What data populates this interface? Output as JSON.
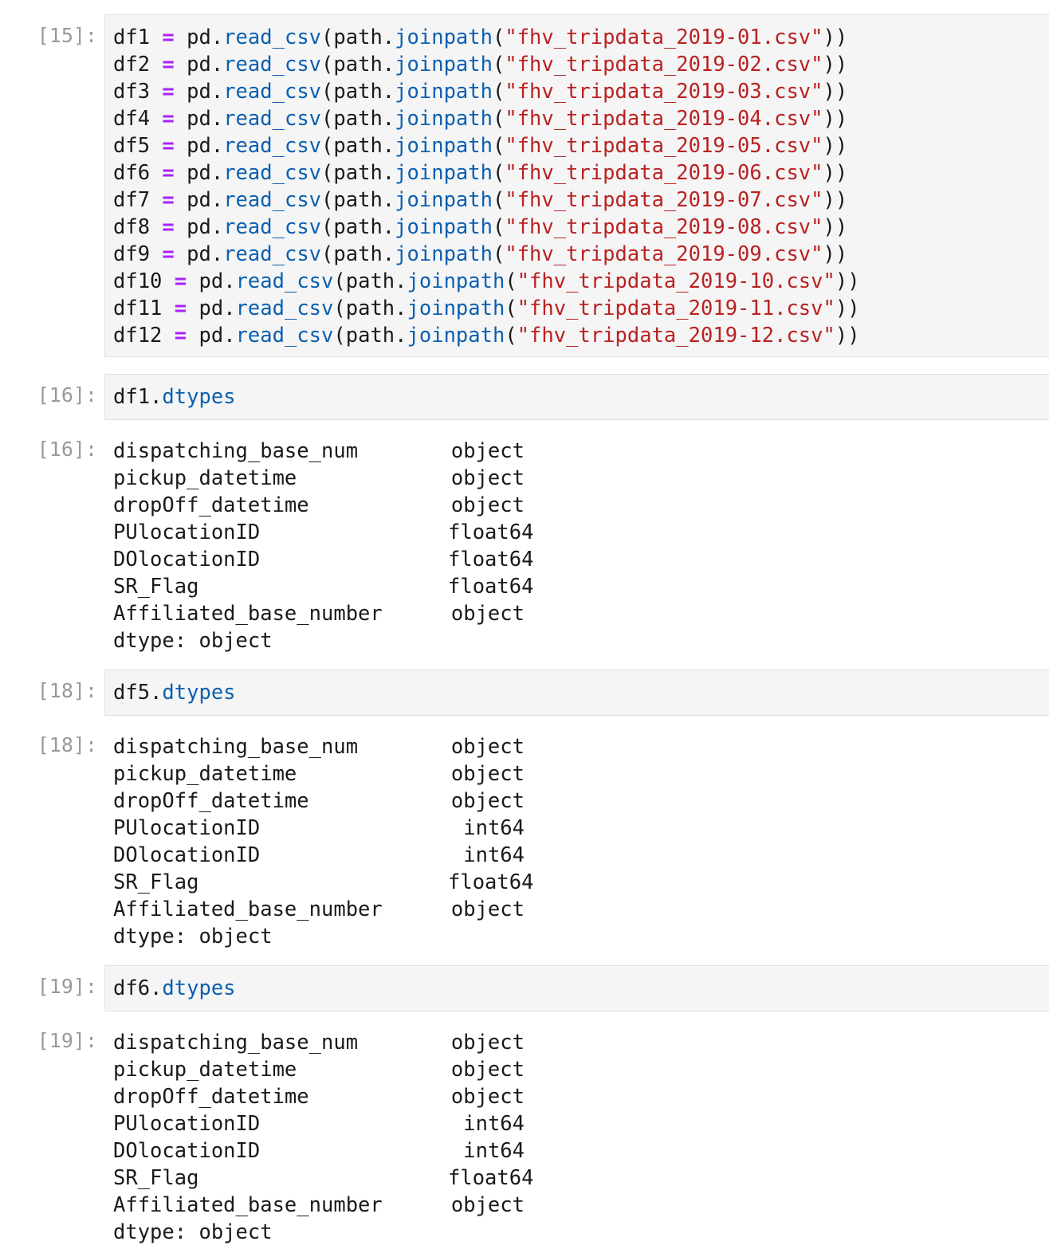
{
  "cells": [
    {
      "id": "cell-15",
      "prompt": "[15]:",
      "type": "input",
      "lines": [
        {
          "var": "df1",
          "file": "\"fhv_tripdata_2019-01.csv\""
        },
        {
          "var": "df2",
          "file": "\"fhv_tripdata_2019-02.csv\""
        },
        {
          "var": "df3",
          "file": "\"fhv_tripdata_2019-03.csv\""
        },
        {
          "var": "df4",
          "file": "\"fhv_tripdata_2019-04.csv\""
        },
        {
          "var": "df5",
          "file": "\"fhv_tripdata_2019-05.csv\""
        },
        {
          "var": "df6",
          "file": "\"fhv_tripdata_2019-06.csv\""
        },
        {
          "var": "df7",
          "file": "\"fhv_tripdata_2019-07.csv\""
        },
        {
          "var": "df8",
          "file": "\"fhv_tripdata_2019-08.csv\""
        },
        {
          "var": "df9",
          "file": "\"fhv_tripdata_2019-09.csv\""
        },
        {
          "var": "df10",
          "file": "\"fhv_tripdata_2019-10.csv\""
        },
        {
          "var": "df11",
          "file": "\"fhv_tripdata_2019-11.csv\""
        },
        {
          "var": "df12",
          "file": "\"fhv_tripdata_2019-12.csv\""
        }
      ],
      "tokens": {
        "eq": "=",
        "pd": "pd.",
        "read_csv": "read_csv",
        "open_paren": "(",
        "path": "path.",
        "joinpath": "joinpath",
        "close": "))"
      }
    },
    {
      "id": "cell-16-in",
      "prompt": "[16]:",
      "obj": "df1.",
      "attr": "dtypes"
    },
    {
      "id": "cell-16-out",
      "prompt": "[16]:",
      "rows": [
        {
          "name": "dispatching_base_num",
          "dtype": "object"
        },
        {
          "name": "pickup_datetime",
          "dtype": "object"
        },
        {
          "name": "dropOff_datetime",
          "dtype": "object"
        },
        {
          "name": "PUlocationID",
          "dtype": "float64"
        },
        {
          "name": "DOlocationID",
          "dtype": "float64"
        },
        {
          "name": "SR_Flag",
          "dtype": "float64"
        },
        {
          "name": "Affiliated_base_number",
          "dtype": "object"
        }
      ],
      "footer": "dtype: object"
    },
    {
      "id": "cell-18-in",
      "prompt": "[18]:",
      "obj": "df5.",
      "attr": "dtypes"
    },
    {
      "id": "cell-18-out",
      "prompt": "[18]:",
      "rows": [
        {
          "name": "dispatching_base_num",
          "dtype": "object"
        },
        {
          "name": "pickup_datetime",
          "dtype": "object"
        },
        {
          "name": "dropOff_datetime",
          "dtype": "object"
        },
        {
          "name": "PUlocationID",
          "dtype": "int64"
        },
        {
          "name": "DOlocationID",
          "dtype": "int64"
        },
        {
          "name": "SR_Flag",
          "dtype": "float64"
        },
        {
          "name": "Affiliated_base_number",
          "dtype": "object"
        }
      ],
      "footer": "dtype: object"
    },
    {
      "id": "cell-19-in",
      "prompt": "[19]:",
      "obj": "df6.",
      "attr": "dtypes"
    },
    {
      "id": "cell-19-out",
      "prompt": "[19]:",
      "rows": [
        {
          "name": "dispatching_base_num",
          "dtype": "object"
        },
        {
          "name": "pickup_datetime",
          "dtype": "object"
        },
        {
          "name": "dropOff_datetime",
          "dtype": "object"
        },
        {
          "name": "PUlocationID",
          "dtype": "int64"
        },
        {
          "name": "DOlocationID",
          "dtype": "int64"
        },
        {
          "name": "SR_Flag",
          "dtype": "float64"
        },
        {
          "name": "Affiliated_base_number",
          "dtype": "object"
        }
      ],
      "footer": "dtype: object"
    }
  ],
  "colors": {
    "operator": "#aa22ff",
    "function": "#0b5fb0",
    "string": "#ba2121",
    "prompt": "#9a9a9a",
    "input_bg": "#f5f5f5",
    "input_border": "#e0e0e0"
  }
}
